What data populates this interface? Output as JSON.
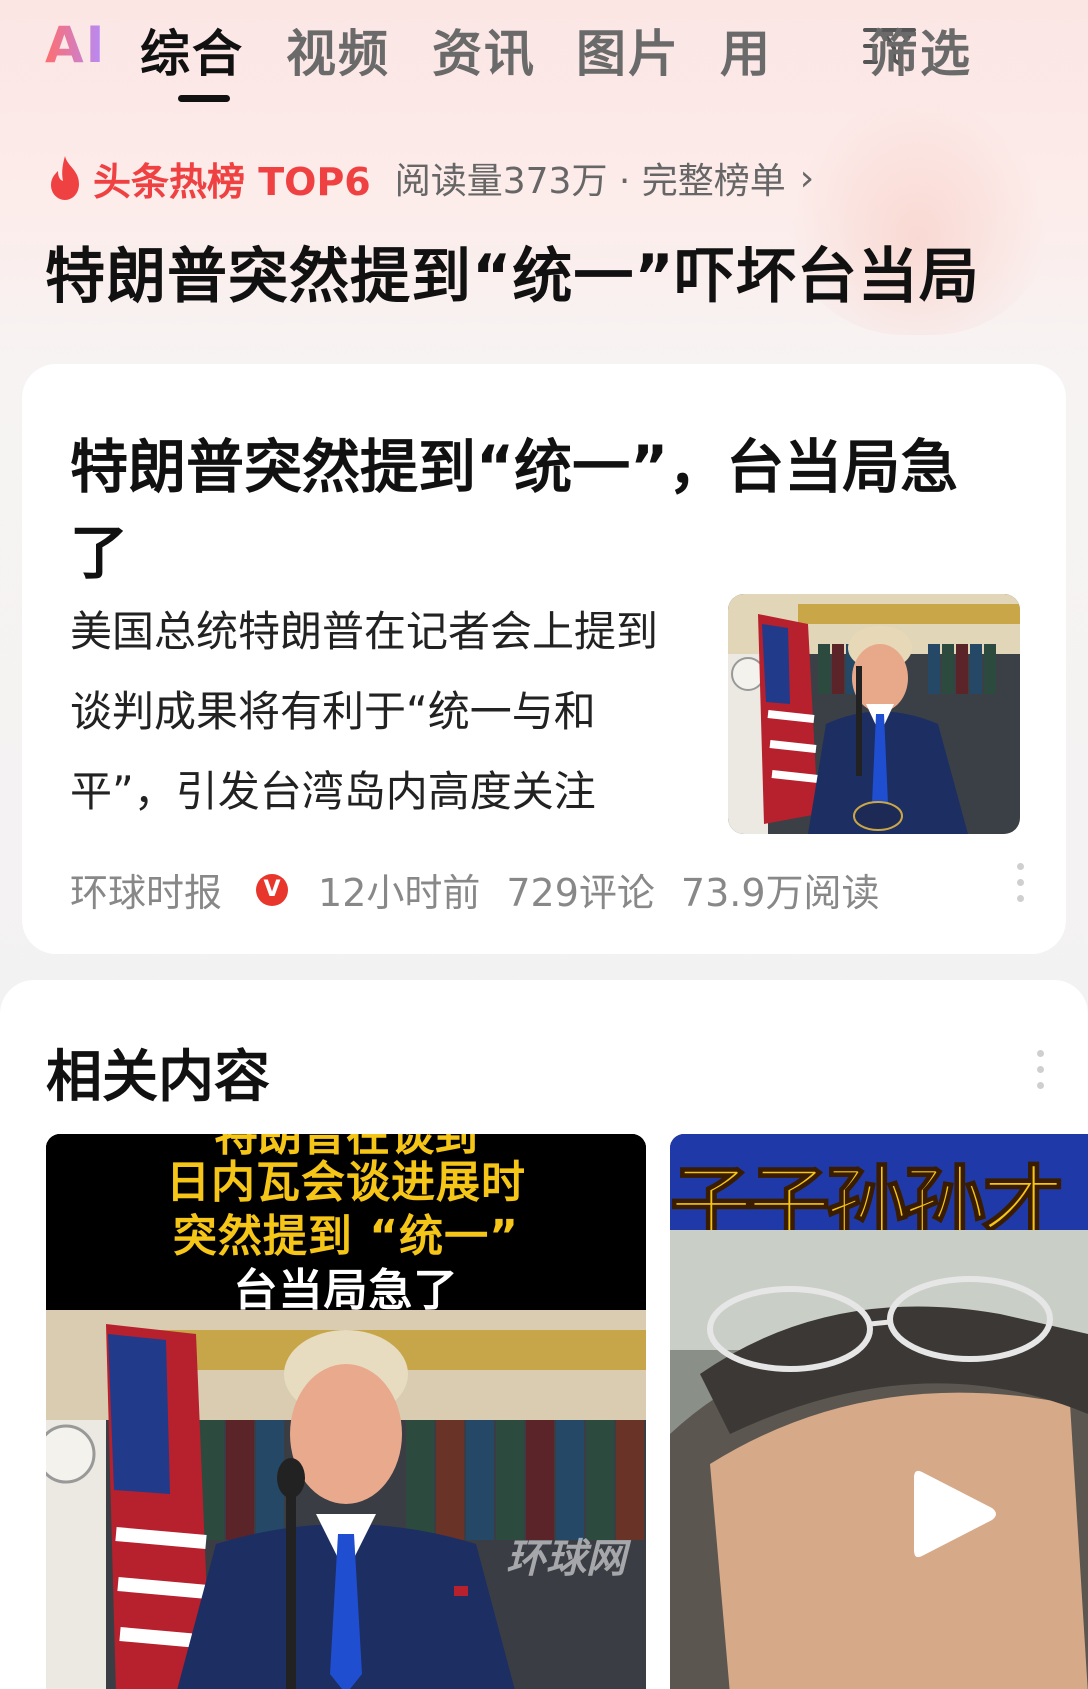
{
  "tabs": [
    {
      "label": "AI"
    },
    {
      "label": "综合"
    },
    {
      "label": "视频"
    },
    {
      "label": "资讯"
    },
    {
      "label": "图片"
    },
    {
      "label": "用"
    }
  ],
  "filter": {
    "label": "筛选",
    "icon": "filter-icon"
  },
  "hot": {
    "label": "头条热榜 TOP6",
    "meta": "阅读量373万 · 完整榜单",
    "chevron": "›",
    "icon": "flame-icon",
    "accent_color": "#f04142"
  },
  "headline": "特朗普突然提到“统一”吓坏台当局",
  "article": {
    "title": "特朗普突然提到“统一”，台当局急了",
    "summary": "美国总统特朗普在记者会上提到谈判成果将有利于“统一与和平”，引发台湾岛内高度关注",
    "source": "环球时报",
    "verified_badge": "V",
    "time": "12小时前",
    "comments": "729评论",
    "reads": "73.9万阅读"
  },
  "related": {
    "title": "相关内容",
    "video_left": {
      "caption_partial": "特朗普在谈到",
      "caption_line1": "日内瓦会谈进展时",
      "caption_line2": "突然提到 “统一”",
      "caption_line3": "台当局急了",
      "watermark": "环球网"
    },
    "video_right": {
      "banner_text": "子子孙孙才",
      "play_icon": "play-icon"
    }
  }
}
